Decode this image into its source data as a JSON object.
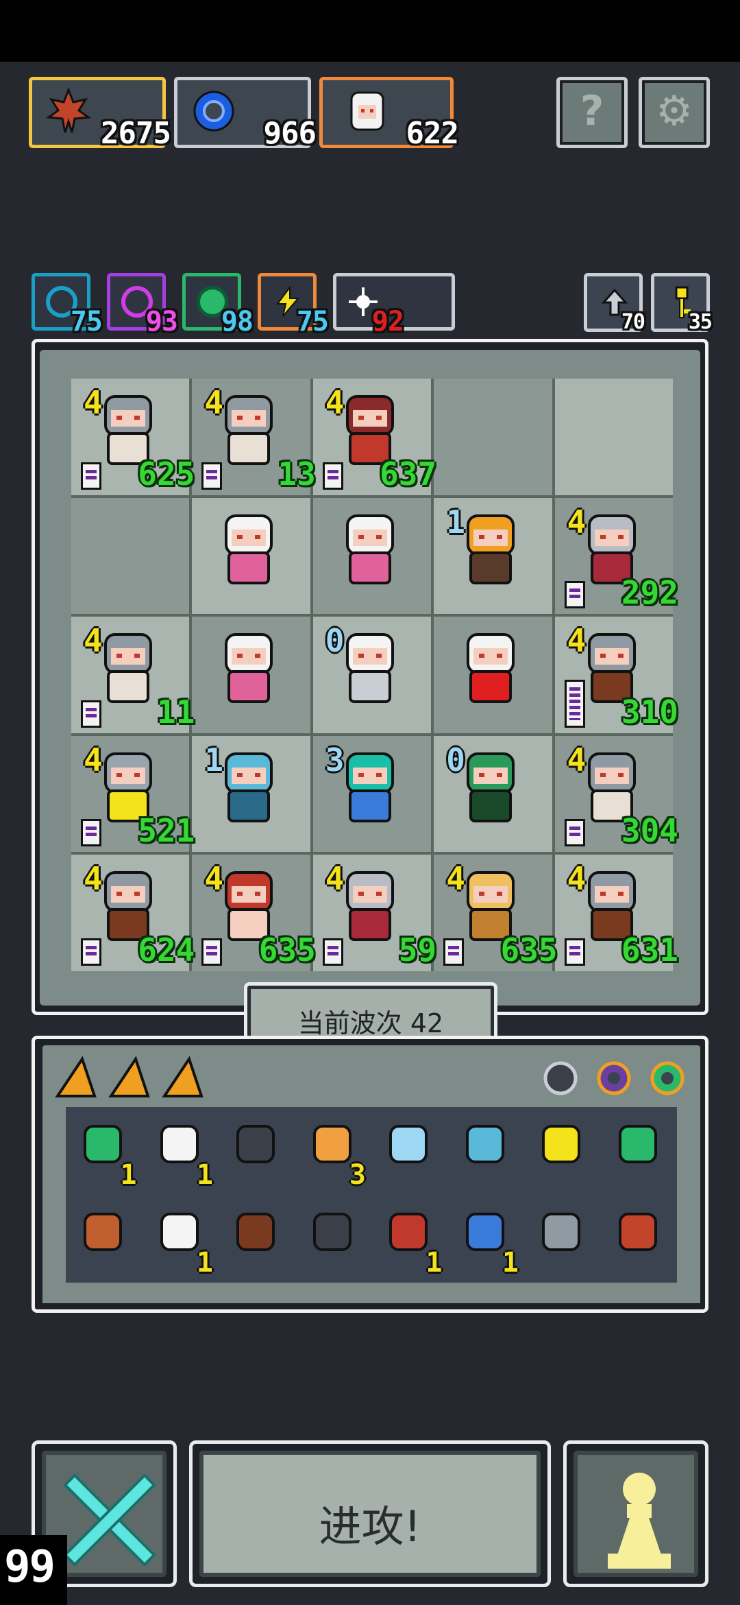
{
  "resources": [
    {
      "name": "maple-leaf",
      "value": "2675",
      "color": "#f5c542"
    },
    {
      "name": "blue-gear",
      "value": "966",
      "color": "#c9ced4"
    },
    {
      "name": "hero-portrait",
      "value": "622",
      "color": "#f0893a"
    }
  ],
  "header_buttons": {
    "help": "?",
    "settings": "⚙"
  },
  "elements": [
    {
      "name": "water",
      "value": "75",
      "color": "#1aa0c8"
    },
    {
      "name": "arcane",
      "value": "93",
      "color": "#a43fe0"
    },
    {
      "name": "nature",
      "value": "98",
      "color": "#2ab86a"
    },
    {
      "name": "lightning",
      "value": "75",
      "color": "#f0893a"
    },
    {
      "name": "light",
      "value": "92",
      "color": "#c9ced4"
    }
  ],
  "small_buttons": {
    "recycle": "70",
    "key": "35"
  },
  "board": {
    "rows": [
      [
        {
          "unit": "knight",
          "level": "4",
          "hp": "625"
        },
        {
          "unit": "knight",
          "level": "4",
          "hp": "13"
        },
        {
          "unit": "red-mage",
          "level": "4",
          "hp": "637"
        },
        {
          "unit": "",
          "level": "",
          "hp": ""
        },
        {
          "unit": "",
          "level": "",
          "hp": ""
        }
      ],
      [
        {
          "unit": "",
          "level": "",
          "hp": ""
        },
        {
          "unit": "white-haired-girl",
          "level": "",
          "hp": ""
        },
        {
          "unit": "white-haired-girl",
          "level": "",
          "hp": ""
        },
        {
          "unit": "candle-totem",
          "level": "1",
          "hp": ""
        },
        {
          "unit": "grey-haired-girl",
          "level": "4",
          "hp": "292"
        }
      ],
      [
        {
          "unit": "knight",
          "level": "4",
          "hp": "11"
        },
        {
          "unit": "white-haired-girl",
          "level": "",
          "hp": ""
        },
        {
          "unit": "bone-dragon",
          "level": "0",
          "hp": ""
        },
        {
          "unit": "white-ghoul",
          "level": "",
          "hp": ""
        },
        {
          "unit": "shield-knight",
          "level": "4",
          "hp": "310"
        }
      ],
      [
        {
          "unit": "armored-knight",
          "level": "4",
          "hp": "521"
        },
        {
          "unit": "blue-golem",
          "level": "1",
          "hp": ""
        },
        {
          "unit": "crystal-portal",
          "level": "3",
          "hp": ""
        },
        {
          "unit": "green-treant",
          "level": "0",
          "hp": ""
        },
        {
          "unit": "knight",
          "level": "4",
          "hp": "304"
        }
      ],
      [
        {
          "unit": "shield-knight",
          "level": "4",
          "hp": "624"
        },
        {
          "unit": "dwarf",
          "level": "4",
          "hp": "635"
        },
        {
          "unit": "grey-haired-girl",
          "level": "4",
          "hp": "59"
        },
        {
          "unit": "golden-golem",
          "level": "4",
          "hp": "635"
        },
        {
          "unit": "shield-knight",
          "level": "4",
          "hp": "631"
        }
      ]
    ]
  },
  "wave_label": "当前波次 42",
  "inventory": {
    "items_row1": [
      {
        "icon": "green-shield-icon",
        "count": "1"
      },
      {
        "icon": "bone-wand-icon",
        "count": "1"
      },
      {
        "icon": "iron-crate-icon",
        "count": ""
      },
      {
        "icon": "orange-bust-icon",
        "count": "3"
      },
      {
        "icon": "crystal-blade-icon",
        "count": ""
      },
      {
        "icon": "blue-molecule-icon",
        "count": ""
      },
      {
        "icon": "green-potion-icon",
        "count": ""
      },
      {
        "icon": "recycle-bin-icon",
        "count": ""
      }
    ],
    "items_row2": [
      {
        "icon": "dark-rune-icon",
        "count": ""
      },
      {
        "icon": "white-cloud-icon",
        "count": "1"
      },
      {
        "icon": "wooden-log-icon",
        "count": ""
      },
      {
        "icon": "camera-box-icon",
        "count": ""
      },
      {
        "icon": "monster-mouth-icon",
        "count": "1"
      },
      {
        "icon": "water-drop-icon",
        "count": "1"
      },
      {
        "icon": "stone-disc-icon",
        "count": ""
      },
      {
        "icon": "maple-leaf-icon",
        "count": ""
      }
    ]
  },
  "bottom": {
    "attack_label": "进攻!",
    "speed": "99"
  }
}
